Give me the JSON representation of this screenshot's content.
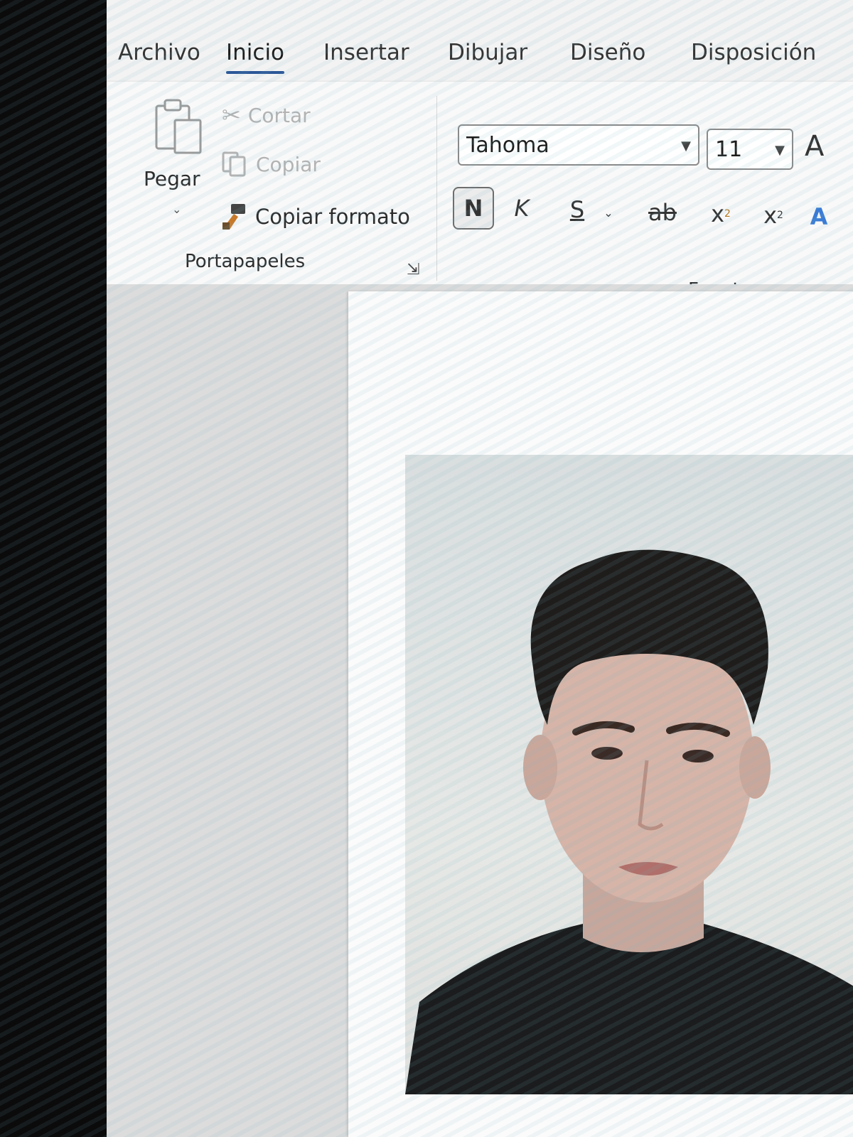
{
  "tabs": [
    {
      "label": "Archivo"
    },
    {
      "label": "Inicio",
      "active": true
    },
    {
      "label": "Insertar"
    },
    {
      "label": "Dibujar"
    },
    {
      "label": "Diseño"
    },
    {
      "label": "Disposición"
    }
  ],
  "clipboard": {
    "paste_label": "Pegar",
    "cut_label": "Cortar",
    "copy_label": "Copiar",
    "format_painter_label": "Copiar formato",
    "group_label": "Portapapeles"
  },
  "font": {
    "font_name": "Tahoma",
    "font_size": "11",
    "bold_label": "N",
    "italic_label": "K",
    "underline_label": "S",
    "strike_label": "ab",
    "subscript_label": "x",
    "superscript_label": "x",
    "grow_label": "A",
    "group_label": "Fuente"
  },
  "colors": {
    "accent": "#2b5797",
    "disabled": "#b3b3b3"
  }
}
